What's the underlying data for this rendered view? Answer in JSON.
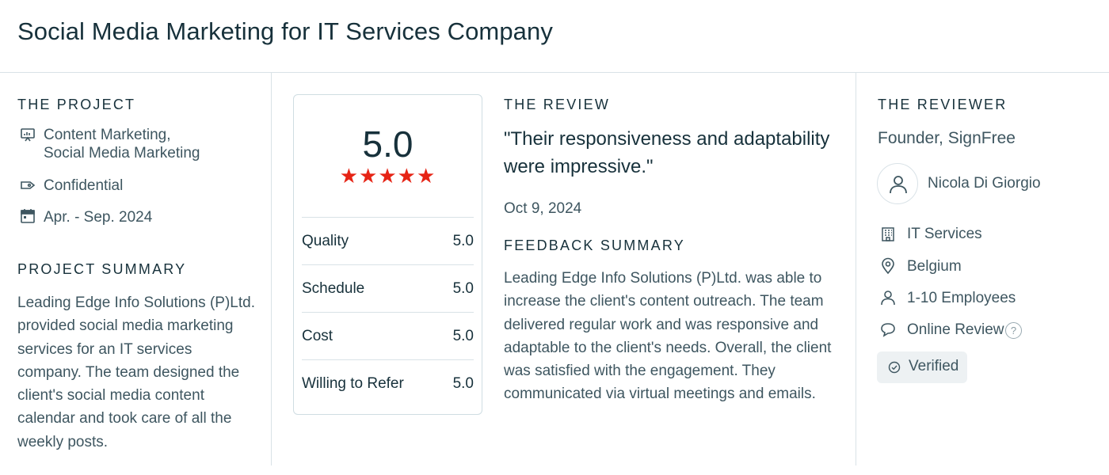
{
  "page_title": "Social Media Marketing for IT Services Company",
  "project": {
    "section_title": "THE PROJECT",
    "services_line1": "Content Marketing,",
    "services_line2": "Social Media Marketing",
    "budget": "Confidential",
    "dates": "Apr. - Sep. 2024",
    "summary_title": "PROJECT SUMMARY",
    "summary_lines": [
      "Leading Edge Info Solutions (P)Ltd.",
      "provided social media marketing",
      "services for an IT services",
      "company. The team designed the",
      "client's social media content",
      "calendar and took care of all the",
      "weekly posts."
    ]
  },
  "rating": {
    "overall": "5.0",
    "stars": "★★★★★",
    "star_count": 5,
    "star_color": "#e62415",
    "rows": [
      {
        "label": "Quality",
        "value": "5.0"
      },
      {
        "label": "Schedule",
        "value": "5.0"
      },
      {
        "label": "Cost",
        "value": "5.0"
      },
      {
        "label": "Willing to Refer",
        "value": "5.0"
      }
    ]
  },
  "review": {
    "section_title": "THE REVIEW",
    "quote_line1": "\"Their responsiveness and adaptability",
    "quote_line2": "were impressive.\"",
    "date": "Oct 9, 2024",
    "feedback_title": "FEEDBACK SUMMARY",
    "feedback_lines": [
      "Leading Edge Info Solutions (P)Ltd. was able to",
      "increase the client's content outreach. The team",
      "delivered regular work and was responsive and",
      "adaptable to the client's needs. Overall, the client",
      "was satisfied with the engagement. They",
      "communicated via virtual meetings and emails."
    ]
  },
  "reviewer": {
    "section_title": "THE REVIEWER",
    "role": "Founder, SignFree",
    "name": "Nicola Di Giorgio",
    "industry": "IT Services",
    "location": "Belgium",
    "size": "1-10 Employees",
    "review_type": "Online Review",
    "help": "?",
    "verified": "Verified"
  },
  "colors": {
    "text_dark": "#17313b",
    "text_body": "#3e5660",
    "divider": "#d9e2e7",
    "star": "#e62415",
    "verified_bg": "#edf1f3"
  },
  "icons": [
    "presentation-icon",
    "tag-icon",
    "calendar-icon",
    "user-icon",
    "building-icon",
    "location-pin-icon",
    "person-icon",
    "chat-bubble-icon",
    "help-circle-icon",
    "check-circle-icon"
  ]
}
